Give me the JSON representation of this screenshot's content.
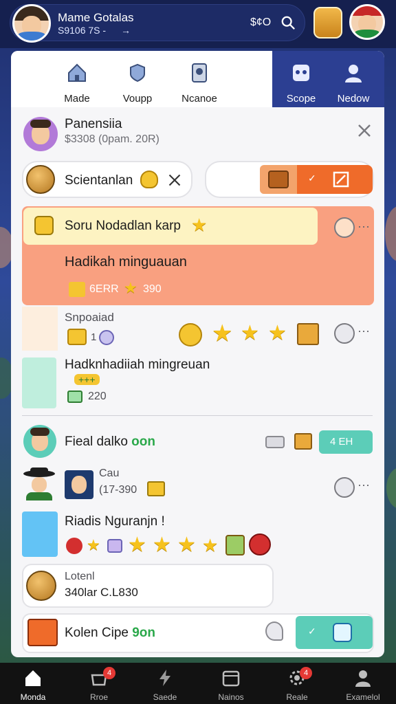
{
  "top_bar": {
    "user_name": "Mame Gotalas",
    "user_sub": "S9106 7S -",
    "counter": "$¢O",
    "user_arrow": "→"
  },
  "tabs": [
    {
      "label": "Made",
      "icon": "home-icon"
    },
    {
      "label": "Voupp",
      "icon": "shield-icon"
    },
    {
      "label": "Ncanoe",
      "icon": "device-icon"
    },
    {
      "label": "Scope",
      "icon": "grid-icon"
    },
    {
      "label": "Nedow",
      "icon": "person-icon"
    }
  ],
  "profile": {
    "name": "Panensiia",
    "sub": "$3308 (0pam. 20R)"
  },
  "search_pill": {
    "label": "Scientanlan"
  },
  "quest_banner": {
    "title": "Soru Nodadlan karp",
    "subtitle": "Hadikah minguauan",
    "reward_label": "6ERR",
    "reward_value": "390"
  },
  "item_special": {
    "label": "Snpoaiad",
    "count": "1"
  },
  "item_weekly": {
    "title": "Hadknhadiiah mingreuan",
    "badge": "+++",
    "value": "220"
  },
  "friend_row": {
    "name": "Fieal dalko",
    "status": "oon",
    "button": "4 EH"
  },
  "chat_row": {
    "title": "Cau",
    "sub": "(17-390"
  },
  "ranking_row": {
    "title": "Riadis Nguranjn !"
  },
  "wallet_row": {
    "title": "Lotenl",
    "sub": "340lar C.L830"
  },
  "gift_row": {
    "title": "Kolen Cipe",
    "status": "9on"
  },
  "bottom_nav": [
    {
      "label": "Monda",
      "active": true
    },
    {
      "label": "Rroe",
      "badge": "4"
    },
    {
      "label": "Saede"
    },
    {
      "label": "Nainos"
    },
    {
      "label": "Reale",
      "badge": "4"
    },
    {
      "label": "Examelol"
    }
  ],
  "colors": {
    "accent": "#2c3f92",
    "banner": "#f9a080",
    "orange": "#ef6b2a",
    "teal": "#5ccdb8"
  }
}
